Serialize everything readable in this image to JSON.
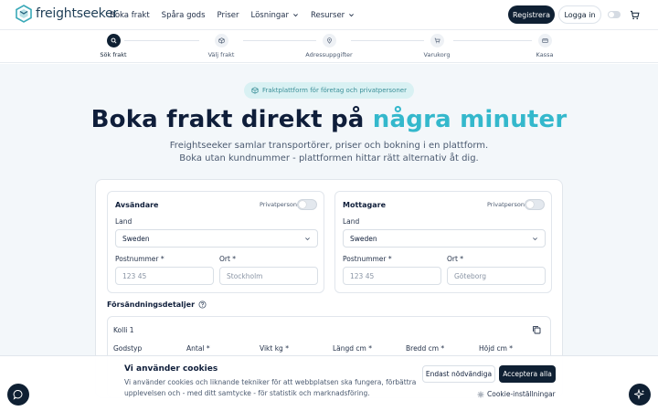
{
  "header": {
    "logo_text": "freightseeker",
    "nav": [
      {
        "label": "Boka frakt",
        "dropdown": false
      },
      {
        "label": "Spåra gods",
        "dropdown": false
      },
      {
        "label": "Priser",
        "dropdown": false
      },
      {
        "label": "Lösningar",
        "dropdown": true
      },
      {
        "label": "Resurser",
        "dropdown": true
      }
    ],
    "register_label": "Registrera",
    "login_label": "Logga in"
  },
  "steps": [
    {
      "label": "Sök frakt",
      "icon": "search-icon",
      "active": true
    },
    {
      "label": "Välj frakt",
      "icon": "box-icon",
      "active": false
    },
    {
      "label": "Adressuppgifter",
      "icon": "map-pin-icon",
      "active": false
    },
    {
      "label": "Varukorg",
      "icon": "cart-icon",
      "active": false
    },
    {
      "label": "Kassa",
      "icon": "card-icon",
      "active": false
    }
  ],
  "hero": {
    "pill": "Fraktplattform för företag och privatpersoner",
    "title_main": "Boka frakt direkt på ",
    "title_accent": "några minuter",
    "sub_line1": "Freightseeker samlar transportörer, priser och bokning i en plattform.",
    "sub_line2": "Boka utan kundnummer - plattformen hittar rätt alternativ åt dig."
  },
  "sender": {
    "title": "Avsändare",
    "private_label": "Privatperson",
    "country_label": "Land",
    "country_value": "Sweden",
    "postal_label": "Postnummer *",
    "postal_placeholder": "123 45",
    "city_label": "Ort *",
    "city_placeholder": "Stockholm"
  },
  "receiver": {
    "title": "Mottagare",
    "private_label": "Privatperson",
    "country_label": "Land",
    "country_value": "Sweden",
    "postal_label": "Postnummer *",
    "postal_placeholder": "123 45",
    "city_label": "Ort *",
    "city_placeholder": "Göteborg"
  },
  "shipment": {
    "title": "Försändningsdetaljer",
    "kolli_title": "Kolli 1",
    "columns": [
      "Godstyp",
      "Antal *",
      "Vikt kg *",
      "Längd cm *",
      "Bredd cm *",
      "Höjd cm *"
    ]
  },
  "cookie": {
    "title": "Vi använder cookies",
    "text": "Vi använder cookies och liknande tekniker för att webbplatsen ska fungera, förbättra upplevelsen och - med ditt samtycke - för statistik och marknadsföring.",
    "necessary_label": "Endast nödvändiga",
    "accept_label": "Acceptera alla",
    "settings_label": "Cookie-inställningar"
  },
  "colors": {
    "primary": "#0f2033",
    "accent": "#34b8cc",
    "pill_bg": "#d9f1f3"
  }
}
